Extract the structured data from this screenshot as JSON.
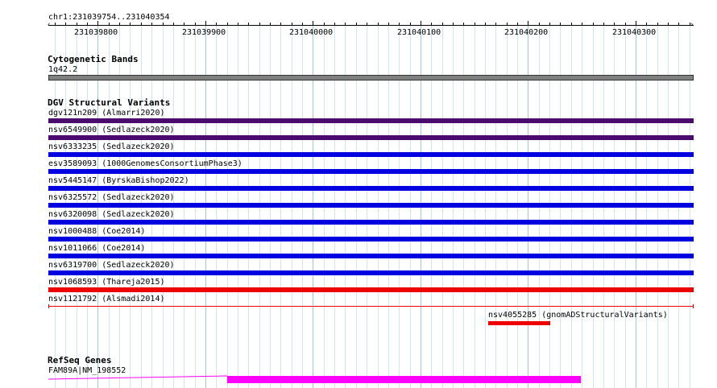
{
  "region": {
    "label": "chr1:231039754..231040354",
    "start": 231039754,
    "end": 231040354
  },
  "ruler": {
    "ticks": [
      "231039800",
      "231039900",
      "231040000",
      "231040100",
      "231040200",
      "231040300"
    ]
  },
  "cytoband": {
    "title": "Cytogenetic Bands",
    "band": "1q42.2",
    "color": "#808080"
  },
  "dgv": {
    "title": "DGV Structural Variants",
    "features": [
      {
        "label": "dgv121n209  (Almarri2020)",
        "start": 231039754,
        "end": 231040354,
        "color": "#4b0a6e",
        "style": "bar"
      },
      {
        "label": "nsv6549900  (Sedlazeck2020)",
        "start": 231039754,
        "end": 231040354,
        "color": "#4b0a6e",
        "style": "bar"
      },
      {
        "label": "nsv6333235  (Sedlazeck2020)",
        "start": 231039754,
        "end": 231040354,
        "color": "#0000e0",
        "style": "bar"
      },
      {
        "label": "esv3589093  (1000GenomesConsortiumPhase3)",
        "start": 231039754,
        "end": 231040354,
        "color": "#0000e0",
        "style": "bar"
      },
      {
        "label": "nsv5445147  (ByrskaBishop2022)",
        "start": 231039754,
        "end": 231040354,
        "color": "#0000e0",
        "style": "bar"
      },
      {
        "label": "nsv6325572  (Sedlazeck2020)",
        "start": 231039754,
        "end": 231040354,
        "color": "#0000e0",
        "style": "bar"
      },
      {
        "label": "nsv6320098  (Sedlazeck2020)",
        "start": 231039754,
        "end": 231040354,
        "color": "#0000e0",
        "style": "bar"
      },
      {
        "label": "nsv1000488  (Coe2014)",
        "start": 231039754,
        "end": 231040354,
        "color": "#0000e0",
        "style": "bar"
      },
      {
        "label": "nsv1011066  (Coe2014)",
        "start": 231039754,
        "end": 231040354,
        "color": "#0000e0",
        "style": "bar"
      },
      {
        "label": "nsv6319700  (Sedlazeck2020)",
        "start": 231039754,
        "end": 231040354,
        "color": "#0000e0",
        "style": "bar"
      },
      {
        "label": "nsv1068593  (Thareja2015)",
        "start": 231039754,
        "end": 231040354,
        "color": "#ee0000",
        "style": "bar"
      },
      {
        "label": "nsv1121792  (Alsmadi2014)",
        "start": 231039754,
        "end": 231040354,
        "color": "#ee0000",
        "style": "thin"
      }
    ],
    "extra": {
      "label": "nsv4055285  (gnomADStructuralVariants)",
      "start": 231040163,
      "end": 231040221,
      "color": "#ee0000"
    }
  },
  "refseq": {
    "title": "RefSeq Genes",
    "gene_label": "FAM89A|NM_198552",
    "color": "#ff00ff",
    "intron_start": 231039754,
    "exon_start": 231039920,
    "exon_end": 231040249
  }
}
